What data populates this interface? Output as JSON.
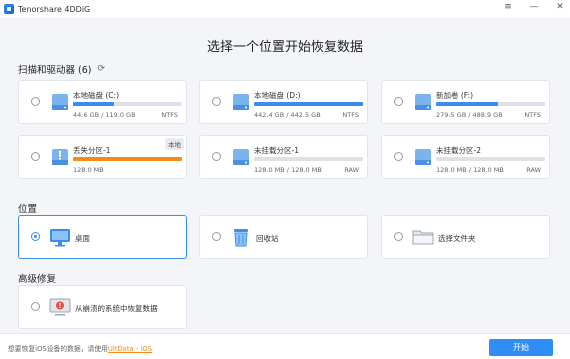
{
  "app": {
    "title": "Tenorshare 4DDiG"
  },
  "window_controls": {
    "menu": "≡",
    "minimize": "—",
    "close": "✕"
  },
  "main_title": "选择一个位置开始恢复数据",
  "drives_section": {
    "label": "扫描和驱动器 (6)"
  },
  "drives": [
    {
      "name": "本地磁盘 (C:)",
      "size": "44.6 GB / 119.0 GB",
      "fs": "NTFS",
      "usage": 0.375,
      "selected": false,
      "lost": false
    },
    {
      "name": "本地磁盘 (D:)",
      "size": "442.4 GB / 442.5 GB",
      "fs": "NTFS",
      "usage": 1.0,
      "selected": false,
      "lost": false
    },
    {
      "name": "新加卷 (F:)",
      "size": "279.5 GB / 488.9 GB",
      "fs": "NTFS",
      "usage": 0.572,
      "selected": false,
      "lost": false
    },
    {
      "name": "丢失分区-1",
      "size": "128.0 MB",
      "fs": "",
      "usage": 1.0,
      "selected": false,
      "lost": true,
      "tag": "本地"
    },
    {
      "name": "未挂载分区-1",
      "size": "128.0 MB / 128.0 MB",
      "fs": "RAW",
      "usage": 0,
      "selected": false,
      "lost": false
    },
    {
      "name": "未挂载分区-2",
      "size": "128.0 MB / 128.0 MB",
      "fs": "RAW",
      "usage": 0,
      "selected": false,
      "lost": false
    }
  ],
  "location_section": {
    "label": "位置"
  },
  "locations": [
    {
      "label": "桌面",
      "icon": "desktop-icon",
      "selected": true
    },
    {
      "label": "回收站",
      "icon": "recycle-bin-icon",
      "selected": false
    },
    {
      "label": "选择文件夹",
      "icon": "folder-icon",
      "selected": false
    }
  ],
  "advanced_section": {
    "label": "高级修复"
  },
  "advanced": [
    {
      "label": "从崩溃的系统中恢复数据",
      "icon": "crashed-system-icon",
      "selected": false
    }
  ],
  "bottom": {
    "text": "想要恢复iOS设备的数据，请使用",
    "link": "UltData - iOS",
    "start_label": "开始"
  },
  "colors": {
    "accent": "#2f8ef5",
    "warning": "#f28a1c"
  }
}
